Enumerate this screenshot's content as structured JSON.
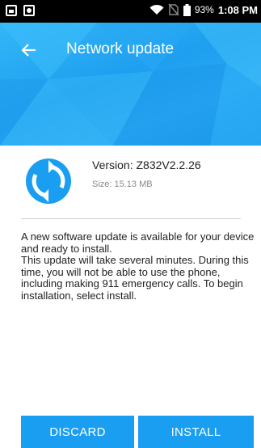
{
  "status_bar": {
    "battery_percent": "93%",
    "time": "1:08 PM"
  },
  "header": {
    "title": "Network update"
  },
  "update": {
    "version": "Version: Z832V2.2.26",
    "size": "Size: 15.13 MB"
  },
  "description": {
    "line1": "A new software update is available for your device and ready to install.",
    "line2": "This update will take several minutes. During this time, you will not be able to use the phone, including making 911 emergency calls. To begin installation, select install."
  },
  "buttons": {
    "discard": "DISCARD",
    "install": "INSTALL"
  },
  "colors": {
    "accent": "#1a9ef2",
    "header": "#2aa8f3",
    "status_bar": "#000000"
  },
  "icons": [
    "gallery-icon",
    "notification-circle-icon",
    "wifi-icon",
    "no-sim-icon",
    "battery-icon",
    "back-arrow-icon",
    "update-sync-icon"
  ]
}
